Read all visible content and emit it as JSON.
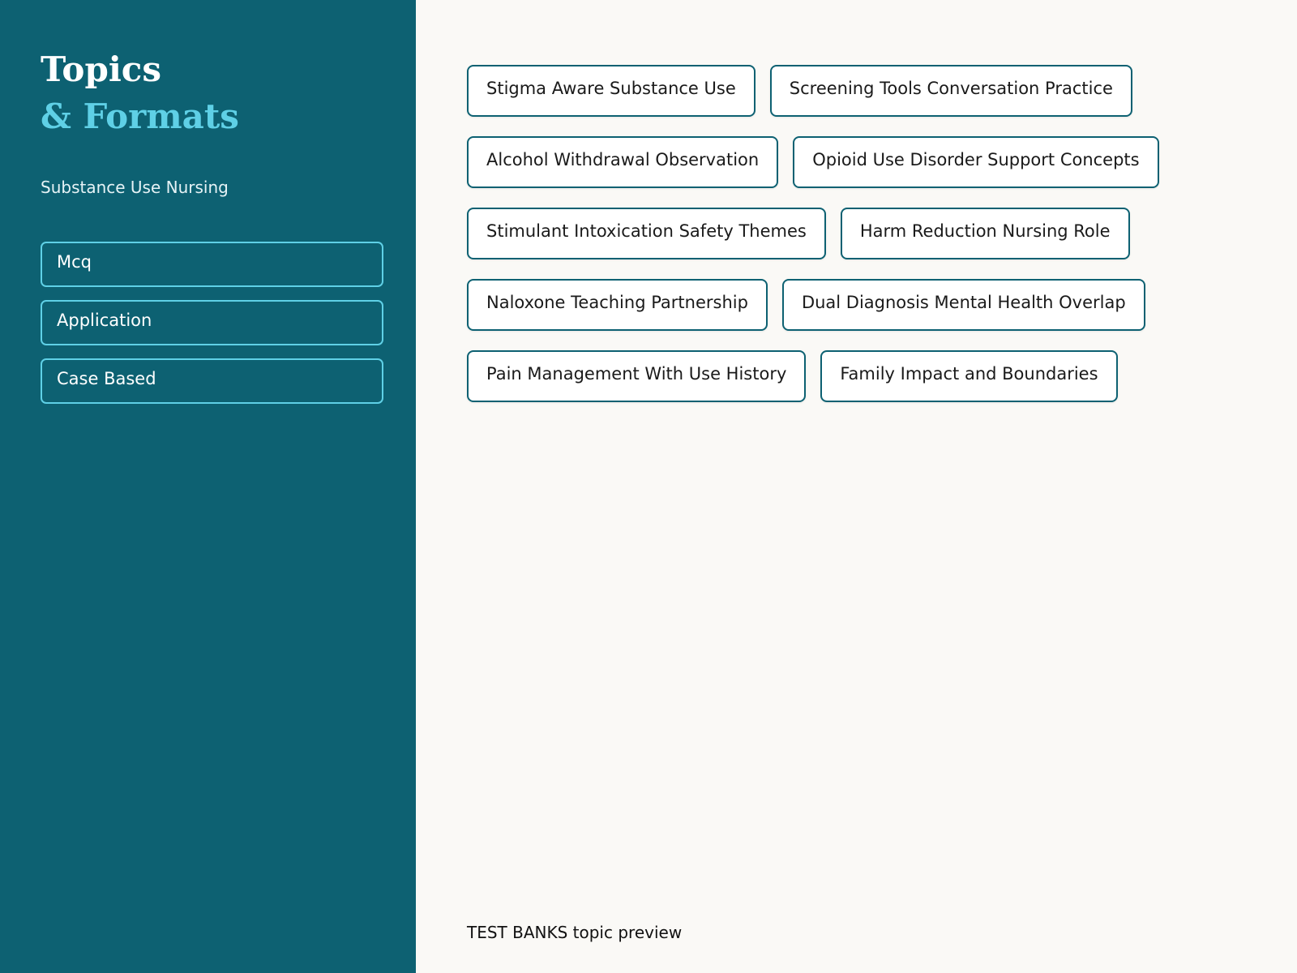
{
  "sidebar": {
    "title_line1": "Topics",
    "title_line2": "& Formats",
    "subtitle": "Substance Use Nursing",
    "formats": [
      "Mcq",
      "Application",
      "Case Based"
    ]
  },
  "topics": [
    "Stigma Aware Substance Use",
    "Screening Tools Conversation Practice",
    "Alcohol Withdrawal Observation",
    "Opioid Use Disorder Support Concepts",
    "Stimulant Intoxication Safety Themes",
    "Harm Reduction Nursing Role",
    "Naloxone Teaching Partnership",
    "Dual Diagnosis Mental Health Overlap",
    "Pain Management With Use History",
    "Family Impact and Boundaries"
  ],
  "footer": {
    "text": "TEST BANKS topic preview"
  },
  "colors": {
    "sidebar_bg": "#0d6172",
    "accent": "#5fd0e6",
    "main_bg": "#faf9f6",
    "chip_border": "#0d6172"
  }
}
